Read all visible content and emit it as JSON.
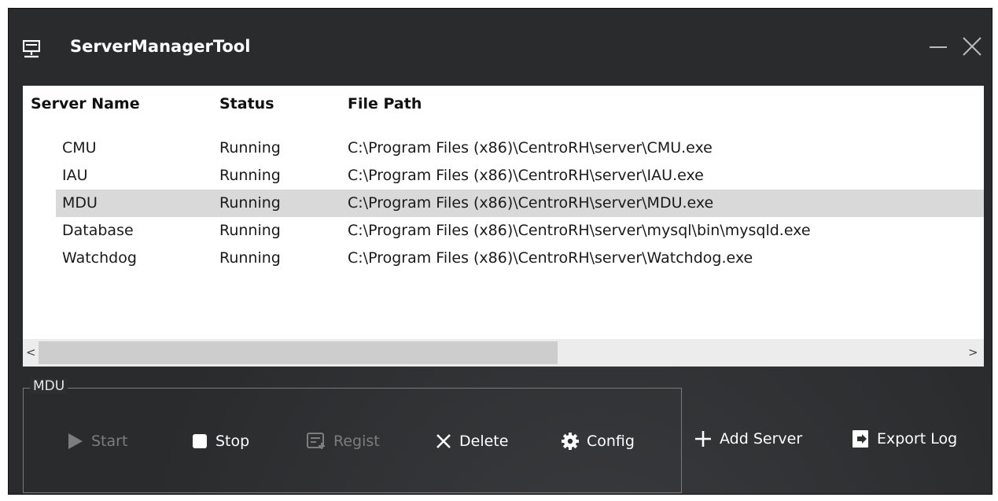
{
  "app": {
    "title": "ServerManagerTool"
  },
  "table": {
    "columns": [
      "Server Name",
      "Status",
      "File Path"
    ],
    "rows": [
      {
        "name": "CMU",
        "status": "Running",
        "path": "C:\\Program Files (x86)\\CentroRH\\server\\CMU.exe"
      },
      {
        "name": "IAU",
        "status": "Running",
        "path": "C:\\Program Files (x86)\\CentroRH\\server\\IAU.exe"
      },
      {
        "name": "MDU",
        "status": "Running",
        "path": "C:\\Program Files (x86)\\CentroRH\\server\\MDU.exe"
      },
      {
        "name": "Database",
        "status": "Running",
        "path": "C:\\Program Files (x86)\\CentroRH\\server\\mysql\\bin\\mysqld.exe"
      },
      {
        "name": "Watchdog",
        "status": "Running",
        "path": "C:\\Program Files (x86)\\CentroRH\\server\\Watchdog.exe"
      }
    ],
    "selected_row": "MDU",
    "scroll_left": "<",
    "scroll_right": ">"
  },
  "group": {
    "title": "MDU",
    "actions": {
      "start": "Start",
      "stop": "Stop",
      "regist": "Regist",
      "delete": "Delete",
      "config": "Config"
    }
  },
  "outer_actions": {
    "add_server": "Add Server",
    "export_log": "Export Log"
  },
  "icons": [
    "server-icon",
    "minimize-icon",
    "close-icon",
    "play-icon",
    "stop-icon",
    "regist-icon",
    "delete-icon",
    "gear-icon",
    "plus-icon",
    "export-icon"
  ],
  "colors": {
    "background": "#2a2b2d",
    "text": "#ffffff",
    "disabled": "#7d7d7d",
    "selection": "#d9d9d9"
  }
}
